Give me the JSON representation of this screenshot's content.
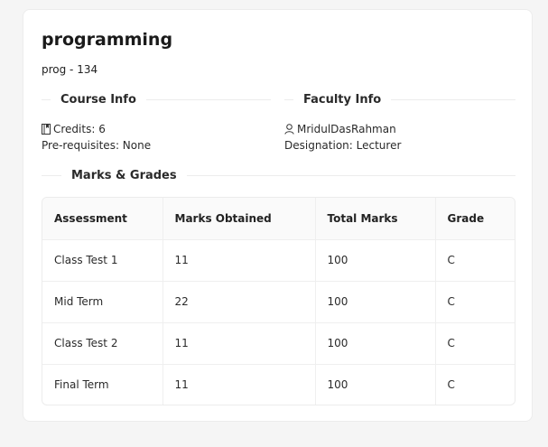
{
  "course": {
    "name": "programming",
    "code": "prog - 134"
  },
  "course_info": {
    "heading": "Course Info",
    "credits_icon": "book-icon",
    "credits": "Credits: 6",
    "prerequisites": "Pre-requisites: None"
  },
  "faculty_info": {
    "heading": "Faculty Info",
    "name_icon": "user-icon",
    "name": "MridulDasRahman",
    "designation": "Designation: Lecturer"
  },
  "marks": {
    "heading": "Marks & Grades",
    "columns": [
      "Assessment",
      "Marks Obtained",
      "Total Marks",
      "Grade"
    ],
    "rows": [
      [
        "Class Test 1",
        "11",
        "100",
        "C"
      ],
      [
        "Mid Term",
        "22",
        "100",
        "C"
      ],
      [
        "Class Test 2",
        "11",
        "100",
        "C"
      ],
      [
        "Final Term",
        "11",
        "100",
        "C"
      ]
    ]
  }
}
